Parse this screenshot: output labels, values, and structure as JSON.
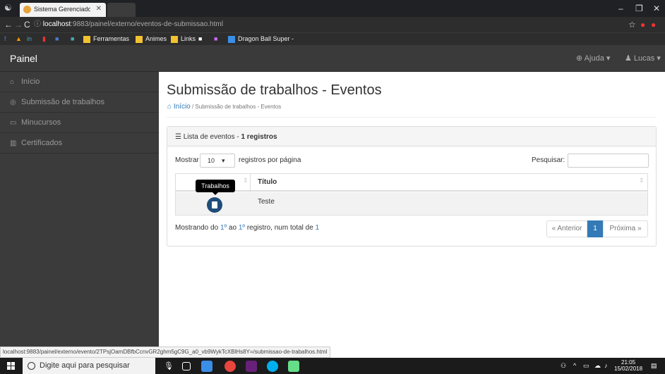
{
  "browser": {
    "tab_title": "Sistema Gerenciador de",
    "url_host": "localhost",
    "url_rest": ":9883/painel/externo/eventos-de-submissao.html",
    "bookmarks": [
      "Ferramentas",
      "Animes",
      "Links",
      "Dragon Ball Super - "
    ]
  },
  "navbar": {
    "brand": "Painel",
    "help": "Ajuda",
    "user": "Lucas"
  },
  "sidebar": {
    "items": [
      {
        "label": "Início",
        "icon": "home-icon"
      },
      {
        "label": "Submissão de trabalhos",
        "icon": "submit-icon"
      },
      {
        "label": "Minucursos",
        "icon": "card-icon"
      },
      {
        "label": "Certificados",
        "icon": "chart-icon"
      }
    ]
  },
  "main": {
    "title": "Submissão de trabalhos - Eventos",
    "breadcrumb_home": "Início",
    "breadcrumb_sep": " / ",
    "breadcrumb_current": "Submissão de trabalhos - Eventos",
    "panel_title": "Lista de eventos - ",
    "panel_count": "1 registros",
    "show_label": "Mostrar",
    "page_size": "10",
    "per_page_label": "registros por página",
    "search_label": "Pesquisar:",
    "search_value": "",
    "column_title": "Título",
    "rows": [
      {
        "title": "Teste"
      }
    ],
    "tooltip": "Trabalhos",
    "showing_pre": "Mostrando do ",
    "showing_from": "1º",
    "showing_mid": " ao ",
    "showing_to": "1º",
    "showing_post": " registro, num total de ",
    "showing_total": "1",
    "prev": "« Anterior",
    "current_page": "1",
    "next": "Próxima »"
  },
  "status_url": "localhost:9883/painel/externo/evento/2TPsjOamDBfbCcnvGR2ghm5gC9G_a0_vb9WykTcXBlHs8Y=/submissao-de-trabalhos.html",
  "taskbar": {
    "search_placeholder": "Digite aqui para pesquisar",
    "time": "21:05",
    "date": "15/02/2018"
  },
  "colors": {
    "navbar": "#3a3a3a",
    "sidebar": "#3b3b3b",
    "link": "#337ab7",
    "doc_button": "#1f4d7a"
  }
}
